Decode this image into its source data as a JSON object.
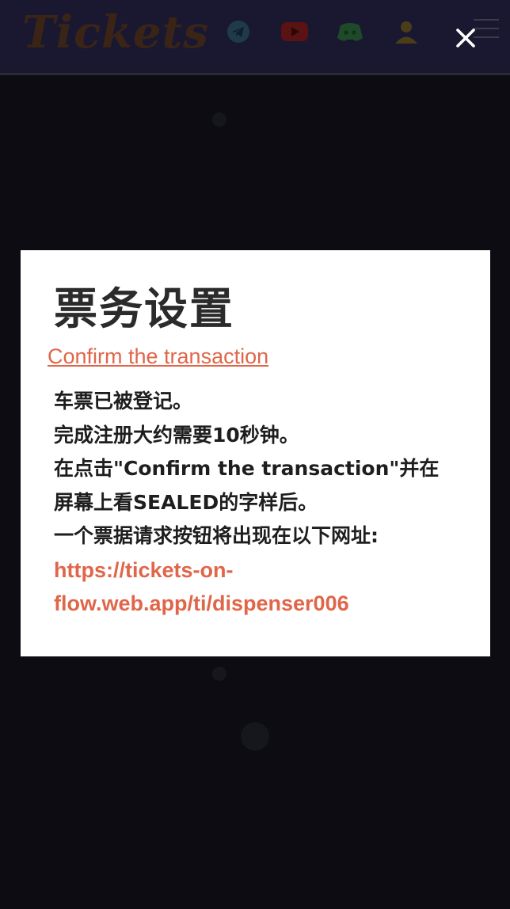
{
  "header": {
    "logo_text": "Tickets",
    "icons": [
      "telegram-icon",
      "youtube-icon",
      "discord-icon",
      "user-icon",
      "menu-icon"
    ]
  },
  "modal": {
    "title": "票务设置",
    "confirm_link": "Confirm the transaction",
    "body_lines": [
      "车票已被登记。",
      "完成注册大约需要10秒钟。",
      "在点击\"Confirm the transaction\"并在",
      "屏幕上看SEALED的字样后。",
      "一个票据请求按钮将出现在以下网址:"
    ],
    "url_lines": [
      "https://tickets-on-",
      "flow.web.app/ti/dispenser006"
    ],
    "close_symbol": "×"
  },
  "colors": {
    "accent": "#e0664a",
    "header_bg": "#1a1830",
    "page_bg": "#0c0c12",
    "modal_bg": "#ffffff"
  }
}
